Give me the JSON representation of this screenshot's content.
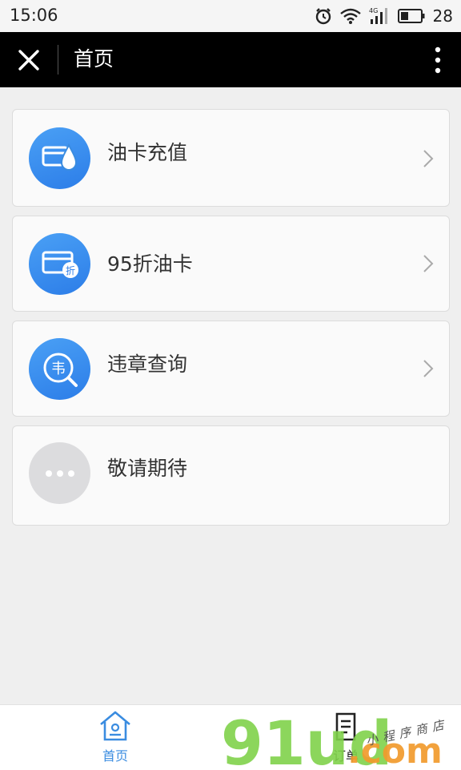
{
  "status_bar": {
    "time": "15:06",
    "battery": "28",
    "network": "4G"
  },
  "nav": {
    "title": "首页"
  },
  "menu": [
    {
      "label": "油卡充值",
      "icon": "fuel-card-icon",
      "chevron": true
    },
    {
      "label": "95折油卡",
      "icon": "discount-card-icon",
      "chevron": true
    },
    {
      "label": "违章查询",
      "icon": "violation-search-icon",
      "chevron": true
    },
    {
      "label": "敬请期待",
      "icon": "more-dots-icon",
      "chevron": false
    }
  ],
  "tabs": [
    {
      "label": "首页",
      "icon": "home-icon",
      "active": true
    },
    {
      "label": "订单",
      "icon": "order-icon",
      "active": false
    }
  ],
  "watermark": {
    "brand": "91ud",
    "domain": ".com",
    "tagline": "小程序商店"
  },
  "colors": {
    "accent": "#3a8ce0",
    "navbar": "#000000",
    "icon_blue": "#2c7de8",
    "watermark_green": "#7fd24a",
    "watermark_orange": "#f19a2c"
  }
}
